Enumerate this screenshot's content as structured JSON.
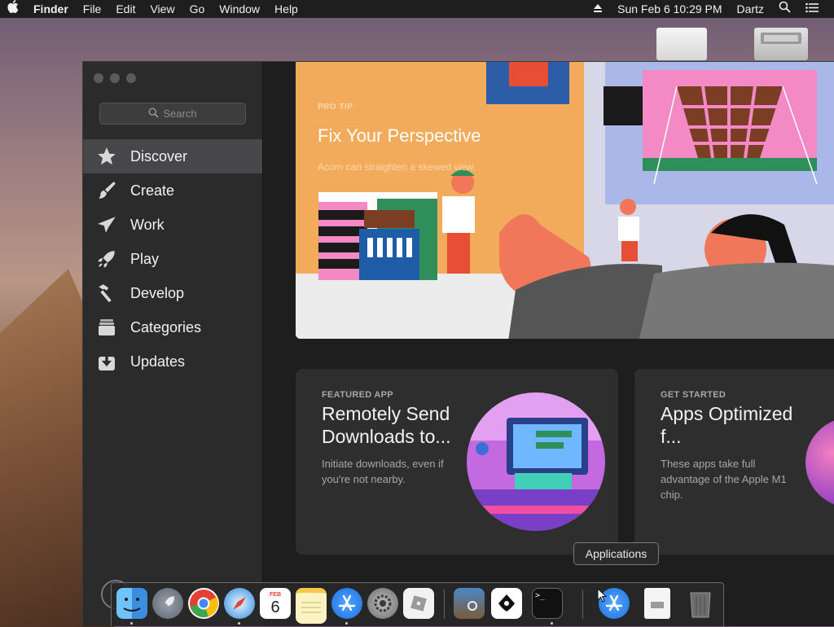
{
  "menubar": {
    "app": "Finder",
    "items": [
      "File",
      "Edit",
      "View",
      "Go",
      "Window",
      "Help"
    ],
    "clock": "Sun Feb 6  10:29 PM",
    "user": "Dartz"
  },
  "sidebar": {
    "search_placeholder": "Search",
    "items": [
      {
        "label": "Discover",
        "icon": "star-icon"
      },
      {
        "label": "Create",
        "icon": "brush-icon"
      },
      {
        "label": "Work",
        "icon": "paper-plane-icon"
      },
      {
        "label": "Play",
        "icon": "rocket-icon"
      },
      {
        "label": "Develop",
        "icon": "hammer-icon"
      },
      {
        "label": "Categories",
        "icon": "stack-icon"
      },
      {
        "label": "Updates",
        "icon": "download-icon"
      }
    ]
  },
  "hero": {
    "eyebrow": "PRO TIP",
    "title": "Fix Your Perspective",
    "subtitle": "Acorn can straighten a skewed view."
  },
  "cards": [
    {
      "eyebrow": "FEATURED APP",
      "title": "Remotely Send Downloads to...",
      "desc": "Initiate downloads, even if you're not nearby."
    },
    {
      "eyebrow": "GET STARTED",
      "title": "Apps Optimized f...",
      "desc": "These apps take full advantage of the Apple M1 chip."
    }
  ],
  "tooltip": "Applications",
  "calendar": {
    "month": "FEB",
    "day": "6"
  },
  "terminal_prompt": ">_",
  "colors": {
    "hero_bg": "#f2aa5b",
    "active_row": "#474749",
    "window_bg": "#1e1e1e"
  }
}
